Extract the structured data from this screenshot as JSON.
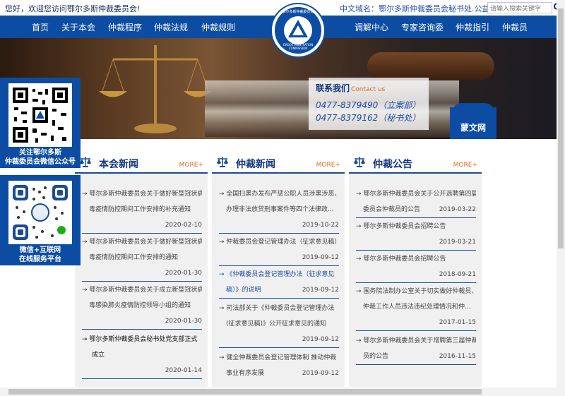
{
  "topbar": {
    "welcome": "您好，欢迎您访问鄂尔多斯仲裁委员会!",
    "domain": "中文域名：鄂尔多斯仲裁委员会秘书处.公益",
    "search_placeholder": "请输入搜索关键字"
  },
  "emblem": {
    "ring_top": "鄂尔多斯仲裁委员会",
    "ring_bottom": "ORDOS ARBITRATION COMMISSION"
  },
  "nav": {
    "left": [
      "首页",
      "关于本会",
      "仲裁程序",
      "仲裁法规",
      "仲裁规则"
    ],
    "right": [
      "调解中心",
      "专家咨询委",
      "仲裁指引",
      "仲裁员"
    ]
  },
  "contact": {
    "title": "联系我们",
    "title_en": "Contact us",
    "phone1": "0477-8379490（立案部）",
    "phone2": "0477-8379162（秘书处）"
  },
  "mongol_label": "蒙文网",
  "qr1": {
    "caption1": "关注鄂尔多斯",
    "caption2": "仲裁委员会微信公众号"
  },
  "qr2": {
    "caption1": "微信+互联网",
    "caption2": "在线服务平台"
  },
  "columns": [
    {
      "title": "本会新闻",
      "more": "MORE+",
      "items": [
        {
          "l1": "→ 鄂尔多斯仲裁委员会关于做好新型冠状病",
          "l2": "毒疫情防控期间工作安排的补充通知",
          "date": "2020-02-10"
        },
        {
          "l1": "→ 鄂尔多斯仲裁委员会关于做好新型冠状病",
          "l2": "毒疫情防控期间工作安排的通知",
          "date": "2020-01-30"
        },
        {
          "l1": "→ 鄂尔多斯仲裁委员会关于成立新型冠状病",
          "l2": "毒感染肺炎疫情防控领导小组的通知",
          "date": "2020-01-30"
        },
        {
          "l1": "→ 鄂尔多斯仲裁委员会秘书处党支部正式",
          "l2": "成立",
          "date": "2020-01-14"
        }
      ]
    },
    {
      "title": "仲裁新闻",
      "more": "MORE+",
      "items": [
        {
          "l1": "→ 全国扫黑办发布严惩公职人员涉黑涉恶、",
          "l2": "办理非法放贷刑事案件等四个法律政...",
          "date": "2019-10-22"
        },
        {
          "l1": "→ 仲裁委员会登记管理办法（征求意见稿）",
          "l2": "",
          "date": "2019-09-12"
        },
        {
          "l1": "→ 《仲裁委员会登记管理办法（征求意见",
          "l2": "稿）》的说明",
          "date": "2019-09-12",
          "hl": true
        },
        {
          "l1": "→ 司法部关于《仲裁委员会登记管理办法",
          "l2": "(征求意见稿)》公开征求意见的通知",
          "date": "2019-09-12"
        },
        {
          "l1": "→ 健全仲裁委员会登记管理体制 推动仲裁",
          "l2": "事业有序发展",
          "date": "2019-09-12"
        }
      ]
    },
    {
      "title": "仲裁公告",
      "more": "MORE+",
      "items": [
        {
          "l1": "→ 鄂尔多斯仲裁委员会关于公开选聘第四届",
          "l2": "委员会仲裁员的公告",
          "date": "2019-03-22"
        },
        {
          "l1": "→ 鄂尔多斯仲裁委员会招聘公告",
          "l2": "",
          "date": "2019-03-21"
        },
        {
          "l1": "→ 鄂尔多斯仲裁委员会招聘公告",
          "l2": "",
          "date": "2018-09-21"
        },
        {
          "l1": "→ 国务院法制办公室关于切实做好仲裁员、",
          "l2": "仲裁工作人员违法违纪处理情况和仲...",
          "date": "2017-01-15"
        },
        {
          "l1": "→ 鄂尔多斯仲裁委员会关于增聘第三届仲裁",
          "l2": "员的公告",
          "date": "2016-11-15"
        }
      ]
    }
  ],
  "colors": {
    "nav": "#0c4ca3",
    "title": "#12367f",
    "more": "#e06a1b"
  }
}
